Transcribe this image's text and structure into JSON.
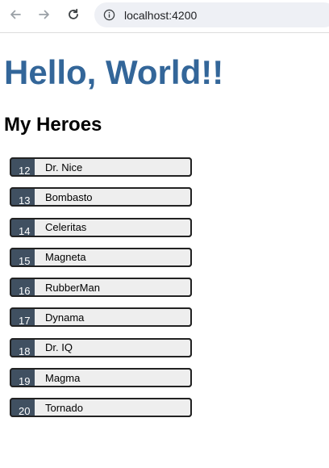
{
  "browser": {
    "url": "localhost:4200",
    "icons": {
      "back": "arrow-left-icon",
      "forward": "arrow-right-icon",
      "reload": "reload-icon",
      "site_info": "info-icon"
    }
  },
  "page": {
    "title": "Hello, World!!",
    "section_title": "My Heroes",
    "title_color": "#336699",
    "badge_color": "#405061"
  },
  "heroes": [
    {
      "id": "12",
      "name": "Dr. Nice"
    },
    {
      "id": "13",
      "name": "Bombasto"
    },
    {
      "id": "14",
      "name": "Celeritas"
    },
    {
      "id": "15",
      "name": "Magneta"
    },
    {
      "id": "16",
      "name": "RubberMan"
    },
    {
      "id": "17",
      "name": "Dynama"
    },
    {
      "id": "18",
      "name": "Dr. IQ"
    },
    {
      "id": "19",
      "name": "Magma"
    },
    {
      "id": "20",
      "name": "Tornado"
    }
  ]
}
